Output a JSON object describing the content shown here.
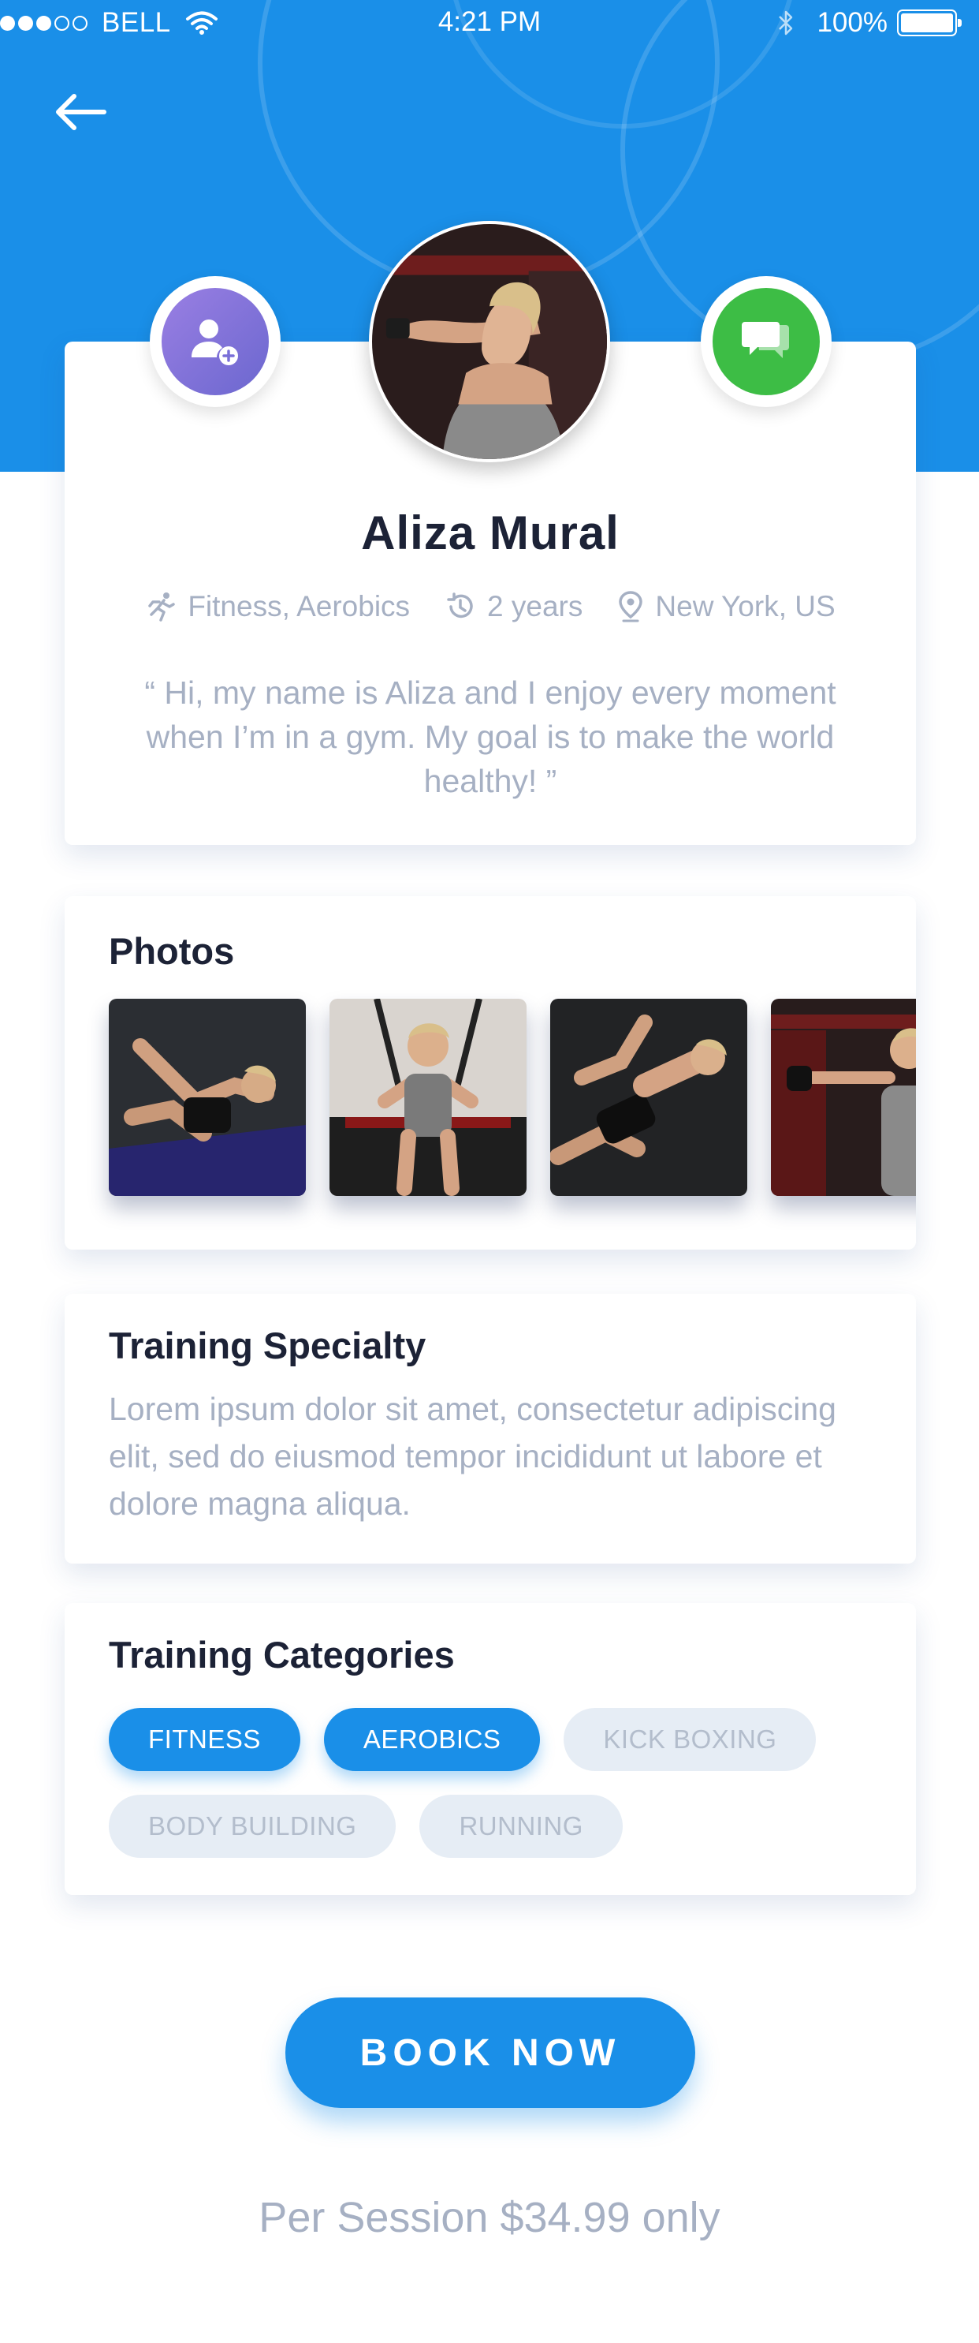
{
  "status_bar": {
    "carrier": "BELL",
    "time": "4:21 PM",
    "battery": "100%"
  },
  "profile": {
    "name": "Aliza Mural",
    "specialty": "Fitness, Aerobics",
    "experience": "2 years",
    "location": "New York, US",
    "quote": "“ Hi, my name is Aliza and I enjoy every moment when I’m in a gym. My goal is to make the world healthy! ”"
  },
  "photos": {
    "title": "Photos"
  },
  "training_specialty": {
    "title": "Training Specialty",
    "text": "Lorem ipsum dolor sit amet, consectetur adipiscing elit, sed do eiusmod tempor incididunt ut labore et dolore magna aliqua."
  },
  "training_categories": {
    "title": "Training Categories",
    "tags": [
      {
        "label": "FITNESS",
        "active": true
      },
      {
        "label": "AEROBICS",
        "active": true
      },
      {
        "label": "KICK BOXING",
        "active": false
      },
      {
        "label": "BODY BUILDING",
        "active": false
      },
      {
        "label": "RUNNING",
        "active": false
      }
    ]
  },
  "book_button": "BOOK NOW",
  "price_text": "Per Session $34.99 only",
  "colors": {
    "primary": "#1a8fe8",
    "add_friend": "#7a6fd8",
    "chat": "#3dbd45",
    "muted_text": "#a6b0c3",
    "inactive_tag": "#e6edf5"
  },
  "icons": [
    "back-arrow-icon",
    "wifi-icon",
    "bluetooth-icon",
    "battery-icon",
    "add-user-icon",
    "chat-icon",
    "running-icon",
    "history-icon",
    "location-pin-icon"
  ]
}
